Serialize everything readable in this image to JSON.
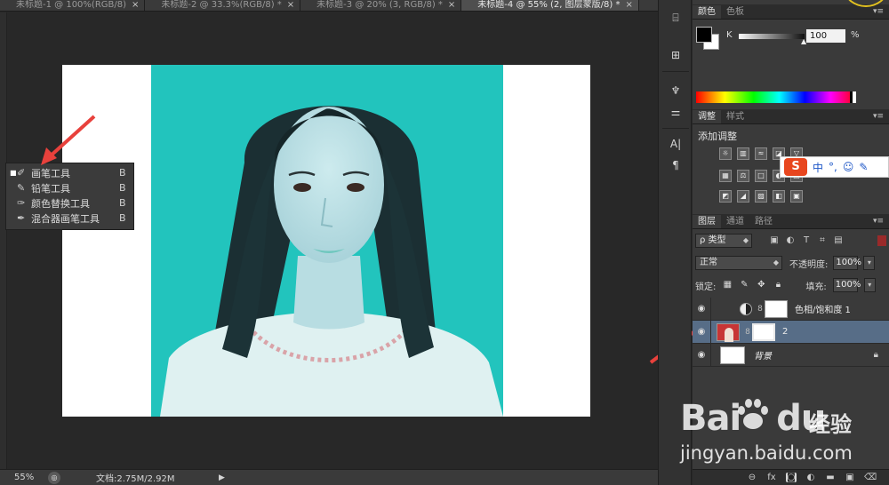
{
  "tabs": [
    {
      "label": "未标题-1 @ 100%(RGB/8)",
      "close": "×"
    },
    {
      "label": "未标题-2 @ 33.3%(RGB/8) *",
      "close": "×"
    },
    {
      "label": "未标题-3 @ 20% (3, RGB/8) *",
      "close": "×"
    },
    {
      "label": "未标题-4 @ 55% (2, 图层蒙版/8) *",
      "close": "×",
      "active": true
    }
  ],
  "tool_flyout": {
    "items": [
      {
        "label": "画笔工具",
        "shortcut": "B",
        "icon": "brush-icon",
        "selected_marker": "■"
      },
      {
        "label": "铅笔工具",
        "shortcut": "B",
        "icon": "pencil-icon"
      },
      {
        "label": "颜色替换工具",
        "shortcut": "B",
        "icon": "color-replace-icon"
      },
      {
        "label": "混合器画笔工具",
        "shortcut": "B",
        "icon": "mixer-brush-icon"
      }
    ]
  },
  "statusbar": {
    "zoom": "55%",
    "doc_size": "文档:2.75M/2.92M"
  },
  "color_panel": {
    "tabs": [
      "颜色",
      "色板"
    ],
    "channel_label": "K",
    "channel_value": "100",
    "unit": "%"
  },
  "adjustments_panel": {
    "tabs": [
      "调整",
      "样式"
    ],
    "title": "添加调整",
    "row1": [
      "☼",
      "▥",
      "≈",
      "◪",
      "▽"
    ],
    "row2": [
      "▦",
      "⚖",
      "□",
      "◐",
      "▤"
    ],
    "row3": [
      "◩",
      "◢",
      "▨",
      "◧",
      "▣"
    ]
  },
  "ime_bar": {
    "logo": "S",
    "items": [
      "中",
      "°,",
      "☺",
      "✎"
    ]
  },
  "layers_panel": {
    "tabs": [
      "图层",
      "通道",
      "路径"
    ],
    "filter_kind": "ρ 类型",
    "blend_mode": "正常",
    "opacity_label": "不透明度:",
    "opacity_value": "100%",
    "lock_label": "锁定:",
    "fill_label": "填充:",
    "fill_value": "100%",
    "layers": [
      {
        "name": "色相/饱和度 1",
        "type": "adjustment",
        "selected": false
      },
      {
        "name": "2",
        "type": "image",
        "selected": true
      },
      {
        "name": "背景",
        "type": "background",
        "selected": false,
        "locked": true
      }
    ]
  },
  "watermark": {
    "logo": "Bai",
    "logo_tail": "du",
    "cn": "经验",
    "url": "jingyan.baidu.com"
  },
  "colors": {
    "photo_bg": "#22c4bd",
    "arrow": "#e8413c",
    "layer_selected": "#576d87"
  }
}
